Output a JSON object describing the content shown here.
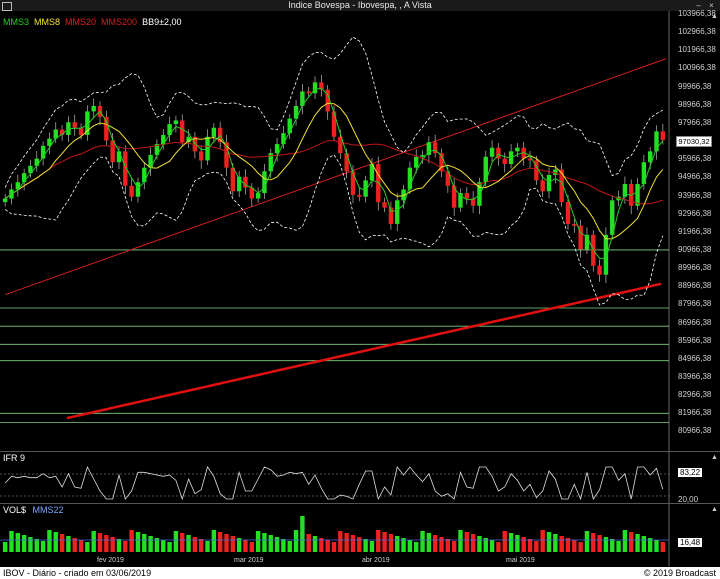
{
  "window": {
    "title": "Indice Bovespa - Ibovespa, , A Vista",
    "icon": "chart-icon",
    "buttons": [
      "minimize",
      "close"
    ]
  },
  "main_legend": [
    {
      "label": "MMS3",
      "color": "#22d022"
    },
    {
      "label": "MMS8",
      "color": "#f0e030"
    },
    {
      "label": "MMS20",
      "color": "#e02020"
    },
    {
      "label": "MMS200",
      "color": "#d02020"
    },
    {
      "label": "BB9±2,00",
      "color": "#ffffff"
    }
  ],
  "price_axis": [
    "103966,38",
    "102966,38",
    "101966,38",
    "100966,38",
    "99966,38",
    "98966,38",
    "97966,38",
    "96966,38",
    "95966,38",
    "94966,38",
    "93966,38",
    "92966,38",
    "91966,38",
    "90966,38",
    "89966,38",
    "88966,38",
    "87966,38",
    "86966,38",
    "85966,38",
    "84966,38",
    "83966,38",
    "82966,38",
    "81966,38",
    "80966,38"
  ],
  "last_price": "97030,32",
  "ifr": {
    "label": "IFR 9",
    "axis": [
      "83,22",
      "20,00"
    ]
  },
  "volume": {
    "label": "VOL$",
    "ma_label": "MMS22",
    "value": "16,48"
  },
  "dates": [
    "fev 2019",
    "mar 2019",
    "abr 2019",
    "mai 2019"
  ],
  "footer": {
    "left": "IBOV - Diário - criado em 03/06/2019",
    "right": "© 2019 Broadcast"
  },
  "colors": {
    "up": "#22e022",
    "down": "#ee2020",
    "grid_line": "#7fd07f"
  },
  "chart_data": {
    "type": "candlestick",
    "title": "Indice Bovespa - Ibovespa, , A Vista",
    "x_ticks": [
      "fev 2019",
      "mar 2019",
      "abr 2019",
      "mai 2019"
    ],
    "ylim": [
      80966.38,
      103966.38
    ],
    "closes": [
      93800,
      94300,
      94700,
      95200,
      95600,
      96000,
      96700,
      97100,
      97600,
      97300,
      98000,
      97700,
      97300,
      98600,
      98900,
      98300,
      97000,
      95800,
      96400,
      94500,
      93900,
      94700,
      95500,
      96200,
      96800,
      97300,
      97900,
      98100,
      96900,
      97200,
      96400,
      95900,
      97200,
      97700,
      96900,
      95500,
      94200,
      95000,
      94400,
      93800,
      94100,
      95300,
      96300,
      96800,
      97400,
      98200,
      98900,
      99700,
      99600,
      100200,
      99800,
      98600,
      97200,
      96300,
      95300,
      94000,
      93900,
      94800,
      95700,
      93600,
      93300,
      92400,
      93700,
      94300,
      95500,
      96100,
      96200,
      96900,
      96300,
      95300,
      94500,
      93300,
      94100,
      93800,
      93400,
      94700,
      96100,
      96600,
      96000,
      95700,
      96400,
      96600,
      96000,
      95900,
      94800,
      94200,
      95100,
      95400,
      93600,
      92400,
      92300,
      91000,
      91800,
      90100,
      89600,
      91800,
      93700,
      93900,
      94600,
      93400,
      94600,
      95800,
      96400,
      97500,
      97030
    ],
    "mms200": [
      81700,
      81800,
      81900,
      82000,
      82100,
      82200,
      82300,
      82400,
      82500,
      82600,
      82700,
      82800,
      82900,
      83000,
      83100,
      83200,
      83300,
      83400,
      83500,
      83600,
      83700,
      83800,
      83900,
      84000,
      84100,
      84200,
      84300,
      84400,
      84500,
      84600,
      84700,
      84800,
      84900,
      85000,
      85100,
      85200,
      85300,
      85400,
      85500,
      85600,
      85700,
      85800,
      85900,
      86000,
      86100,
      86200,
      86300,
      86400,
      86500,
      86600,
      86700,
      86800,
      86900,
      87000,
      87100,
      87200,
      87300,
      87400,
      87500,
      87600,
      87700,
      87800,
      87900,
      88000,
      88100,
      88200,
      88300,
      88400,
      88500,
      88600,
      88700,
      88800,
      88900,
      89000,
      89100
    ],
    "horizontal_levels": [
      90966.38,
      87766.38,
      86766.38,
      85766.38,
      84866.38,
      81966.38,
      81466.38
    ],
    "trend_line": {
      "from": [
        0,
        88500
      ],
      "to": [
        104,
        101500
      ]
    }
  }
}
